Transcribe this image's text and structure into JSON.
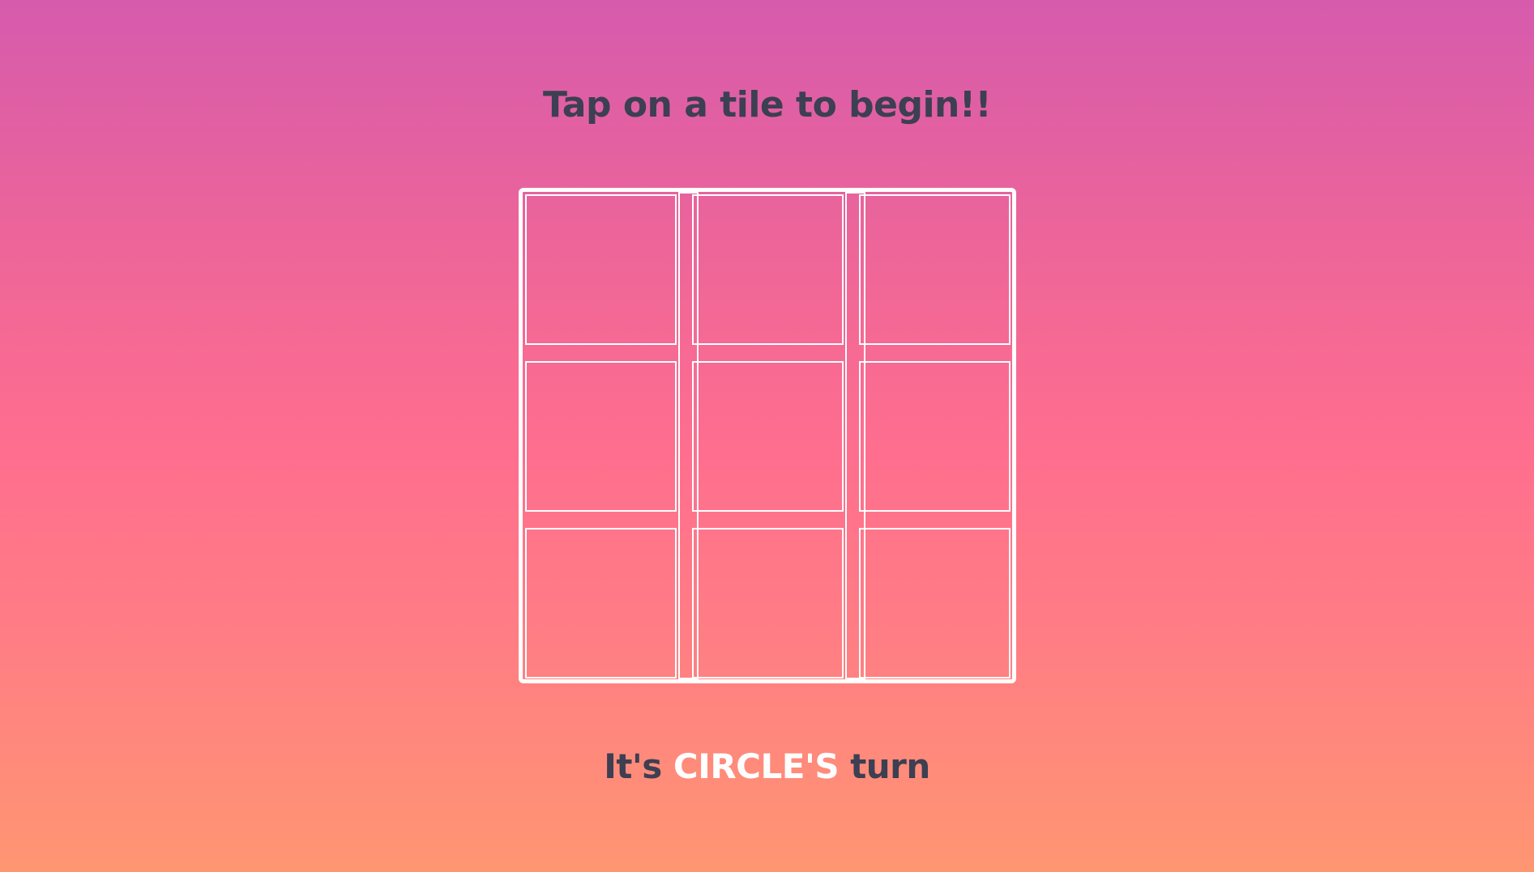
{
  "header": {
    "title": "Tap on a tile to begin!!"
  },
  "board": {
    "rows": 3,
    "cols": 3,
    "tiles": [
      "",
      "",
      "",
      "",
      "",
      "",
      "",
      "",
      ""
    ]
  },
  "status": {
    "prefix": "It's ",
    "player": "CIRCLE'S",
    "suffix": " turn"
  },
  "colors": {
    "text_dark": "#3d3f52",
    "highlight": "#ffffff",
    "gradient_top": "#d65bad",
    "gradient_bottom": "#ff9672"
  }
}
